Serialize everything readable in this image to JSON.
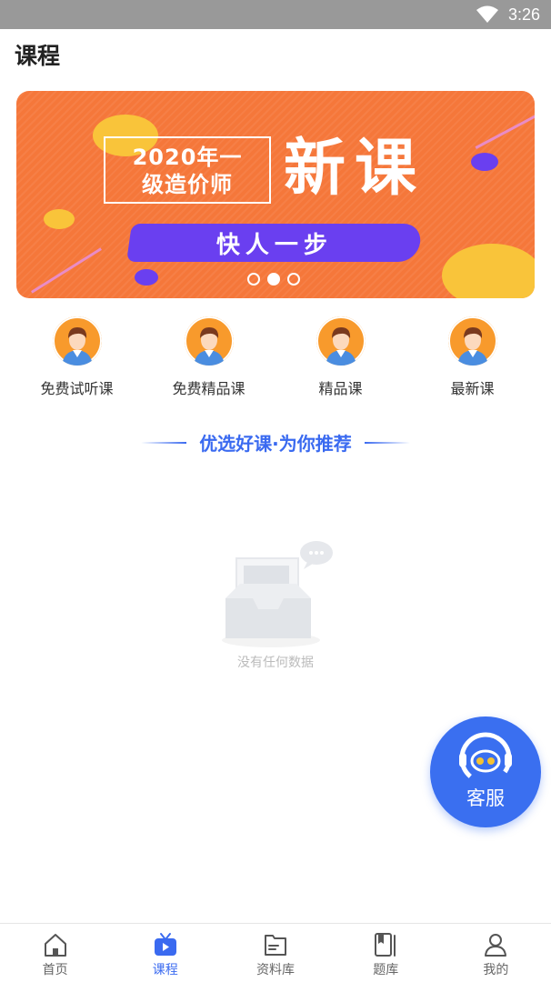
{
  "status_bar": {
    "time": "3:26"
  },
  "header": {
    "title": "课程"
  },
  "banner": {
    "title_line1": "2020年一",
    "title_line2": "级造价师",
    "big_text": "新课",
    "pill_text": "快人一步",
    "page_count": 3,
    "active_index": 1
  },
  "categories": [
    {
      "label": "免费试听课",
      "icon": "avatar-icon"
    },
    {
      "label": "免费精品课",
      "icon": "avatar-icon"
    },
    {
      "label": "精品课",
      "icon": "avatar-icon"
    },
    {
      "label": "最新课",
      "icon": "avatar-icon"
    }
  ],
  "recommend": {
    "title": "优选好课·为你推荐"
  },
  "empty_state": {
    "text": "没有任何数据"
  },
  "service_button": {
    "label": "客服"
  },
  "bottom_nav": {
    "active": "课程",
    "items": [
      {
        "label": "首页",
        "icon": "home-icon"
      },
      {
        "label": "课程",
        "icon": "course-icon"
      },
      {
        "label": "资料库",
        "icon": "folder-icon"
      },
      {
        "label": "题库",
        "icon": "book-icon"
      },
      {
        "label": "我的",
        "icon": "user-icon"
      }
    ]
  },
  "colors": {
    "accent": "#3a6af0",
    "banner": "#f5773a",
    "status_bar": "#999999"
  }
}
